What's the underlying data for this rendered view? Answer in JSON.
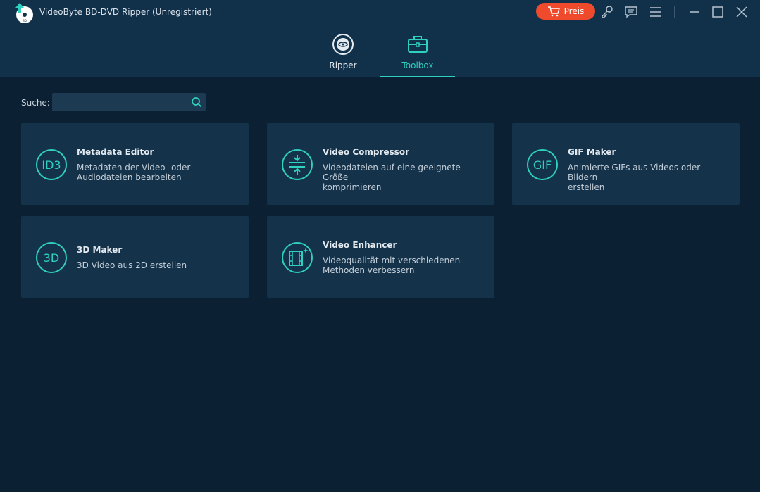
{
  "app": {
    "title": "VideoByte BD-DVD Ripper (Unregistriert)",
    "accent_color": "#2fd0be",
    "price_color": "#ef4a2b"
  },
  "toolbar": {
    "price_label": "Preis",
    "icons": [
      "cart-icon",
      "key-icon",
      "feedback-icon",
      "menu-icon",
      "minimize-icon",
      "maximize-icon",
      "close-icon"
    ]
  },
  "tabs": [
    {
      "label": "Ripper",
      "icon": "disc-icon",
      "active": false
    },
    {
      "label": "Toolbox",
      "icon": "toolbox-icon",
      "active": true
    }
  ],
  "search": {
    "label": "Suche:",
    "value": "",
    "placeholder": ""
  },
  "tools": [
    {
      "title": "Metadata Editor",
      "desc1": "Metadaten der Video- oder",
      "desc2": "Audiodateien bearbeiten",
      "icon_text": "ID3"
    },
    {
      "title": "Video Compressor",
      "desc1": "Videodateien auf eine geeignete Größe",
      "desc2": "komprimieren",
      "icon": "compress-icon"
    },
    {
      "title": "GIF Maker",
      "desc1": "Animierte GIFs aus Videos oder Bildern",
      "desc2": "erstellen",
      "icon_text": "GIF"
    },
    {
      "title": "3D Maker",
      "desc1": "3D Video aus 2D erstellen",
      "icon_text": "3D"
    },
    {
      "title": "Video Enhancer",
      "desc1": "Videoqualität mit verschiedenen",
      "desc2": "Methoden verbessern",
      "icon": "enhance-icon"
    }
  ]
}
